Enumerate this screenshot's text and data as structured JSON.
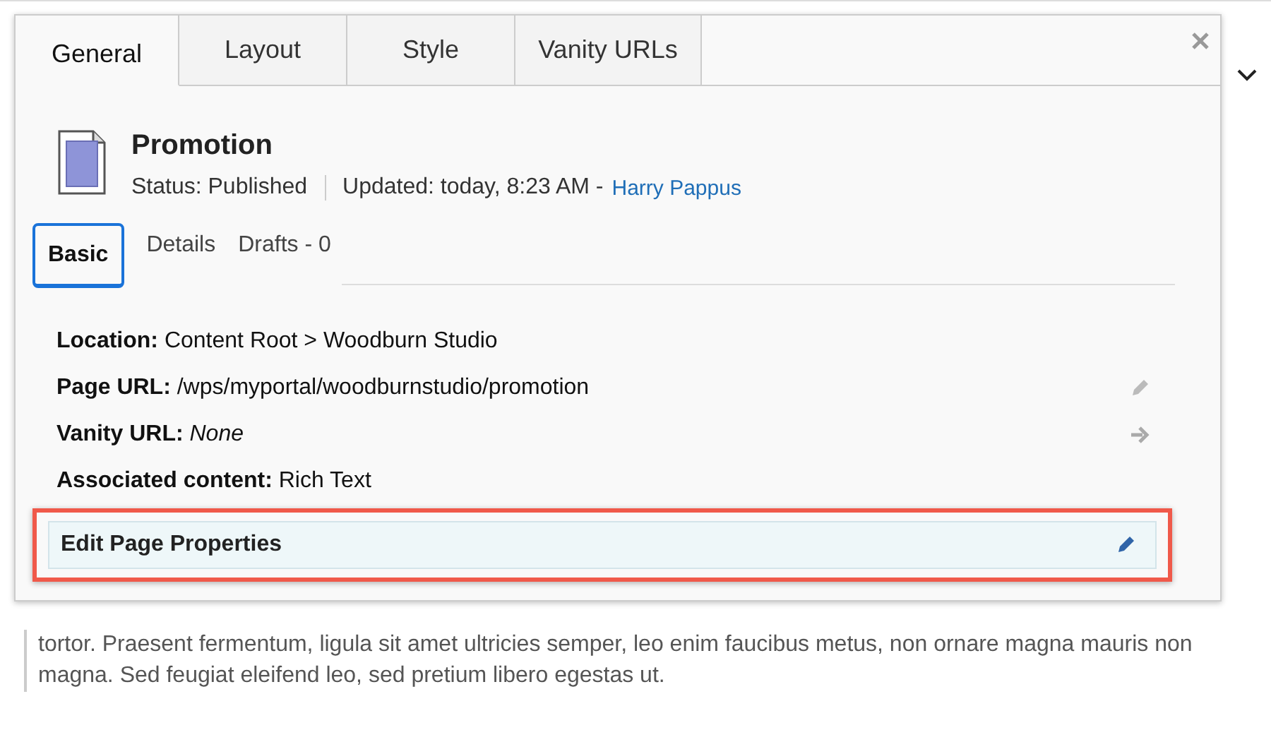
{
  "dialog": {
    "tabs": [
      {
        "label": "General",
        "selected": true
      },
      {
        "label": "Layout",
        "selected": false
      },
      {
        "label": "Style",
        "selected": false
      },
      {
        "label": "Vanity URLs",
        "selected": false
      }
    ],
    "page": {
      "title": "Promotion",
      "status": "Status: Published",
      "updated": "Updated: today, 8:23 AM -",
      "author": "Harry Pappus"
    },
    "subtabs": [
      {
        "label": "Basic",
        "selected": true
      },
      {
        "label": "Details",
        "selected": false
      },
      {
        "label": "Drafts - 0",
        "selected": false
      }
    ],
    "properties": [
      {
        "kind": "plain",
        "label": "Location:",
        "value": "Content Root > Woodburn Studio",
        "italic": false
      },
      {
        "kind": "editable",
        "label": "Page URL:",
        "value": "/wps/myportal/woodburnstudio/promotion",
        "italic": false
      },
      {
        "kind": "link",
        "label": "Vanity URL:",
        "value": "None",
        "italic": true
      },
      {
        "kind": "plain",
        "label": "Associated content:",
        "value": "Rich Text",
        "italic": false
      }
    ],
    "edit_button": {
      "label": "Edit Page Properties",
      "highlighted": true
    }
  },
  "background_text": "tortor. Praesent fermentum, ligula sit amet ultricies semper, leo enim faucibus metus, non ornare magna mauris non magna. Sed feugiat eleifend leo, sed pretium libero egestas ut."
}
